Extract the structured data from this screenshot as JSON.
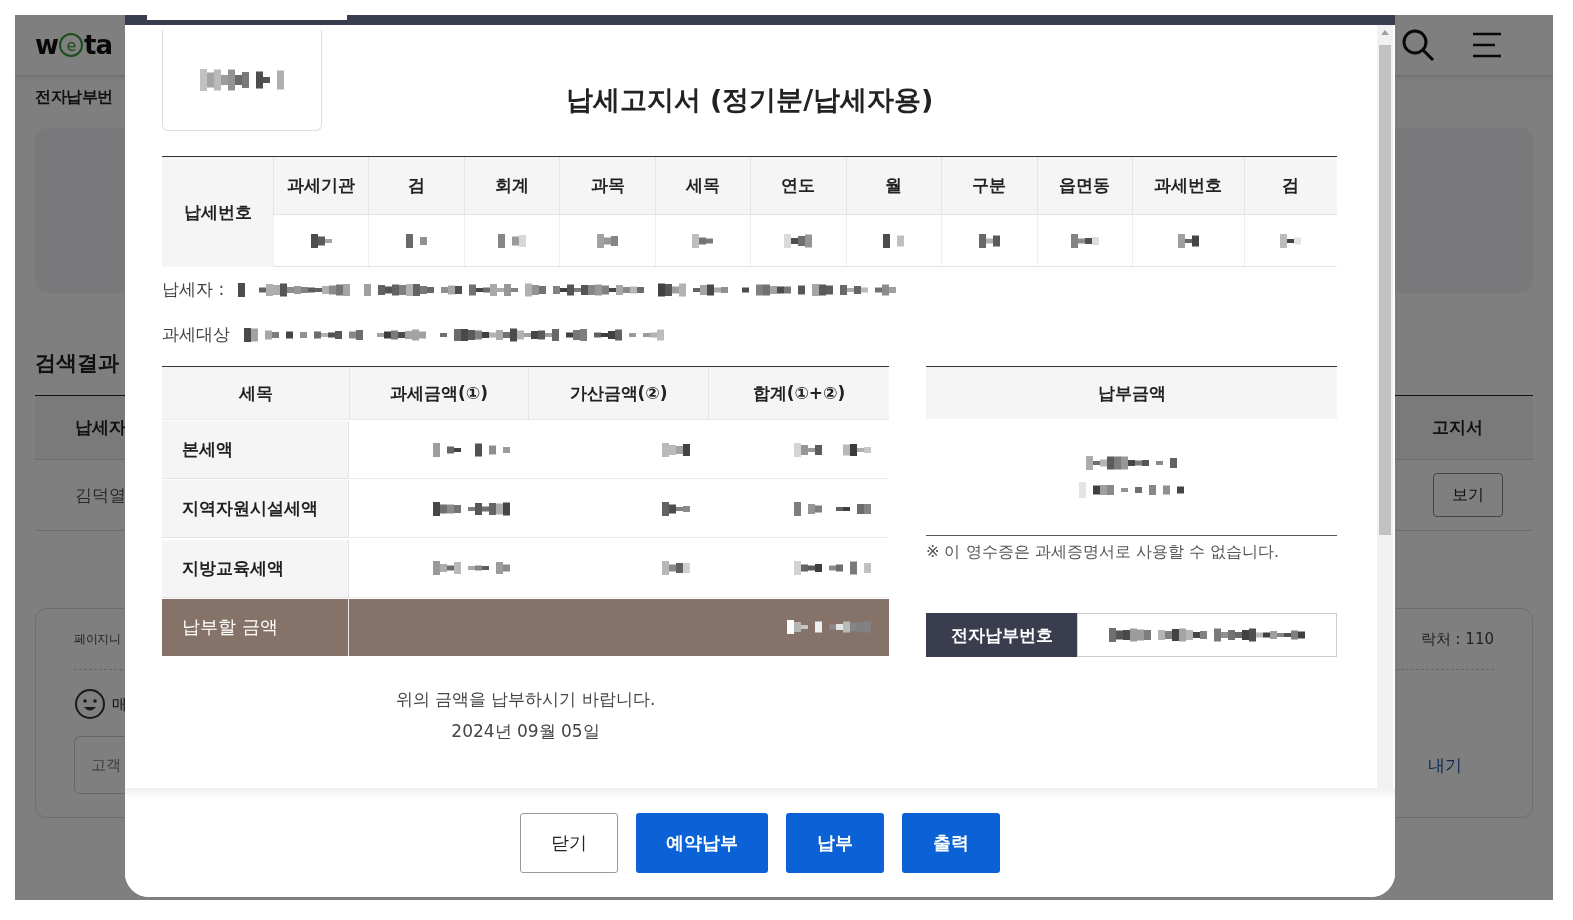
{
  "background": {
    "logo": [
      "w",
      "e",
      "ta"
    ],
    "page_title": "전자납부번",
    "results_heading": "검색결과",
    "results_table": {
      "columns": [
        "납세자",
        "고지서"
      ],
      "rows": [
        {
          "payer": "김덕열",
          "view": "보기"
        }
      ]
    },
    "feedback": {
      "title": "페이지니",
      "contact": "락처 : 110",
      "rating_label": "매",
      "placeholder": "고객",
      "link": "내기"
    }
  },
  "modal": {
    "title": "납세고지서 (정기분/납세자용)",
    "tax_number": {
      "label": "납세번호",
      "columns": [
        "과세기관",
        "검",
        "회계",
        "과목",
        "세목",
        "연도",
        "월",
        "구분",
        "읍면동",
        "과세번호",
        "검"
      ]
    },
    "payer_label": "납세자 :",
    "object_label": "과세대상",
    "amounts": {
      "columns": [
        "세목",
        "과세금액(①)",
        "가산금액(②)",
        "합계(①+②)"
      ],
      "rows": [
        "본세액",
        "지역자원시설세액",
        "지방교육세액"
      ],
      "total_label": "납부할 금액"
    },
    "payment": {
      "heading": "납부금액",
      "note": "※ 이 영수증은 과세증명서로 사용할 수 없습니다.",
      "epay_label": "전자납부번호"
    },
    "request": "위의 금액을 납부하시기 바랍니다.",
    "date": "2024년 09월 05일",
    "buttons": [
      {
        "label": "닫기",
        "kind": "secondary"
      },
      {
        "label": "예약납부",
        "kind": "primary"
      },
      {
        "label": "납부",
        "kind": "primary"
      },
      {
        "label": "출력",
        "kind": "primary"
      }
    ]
  }
}
